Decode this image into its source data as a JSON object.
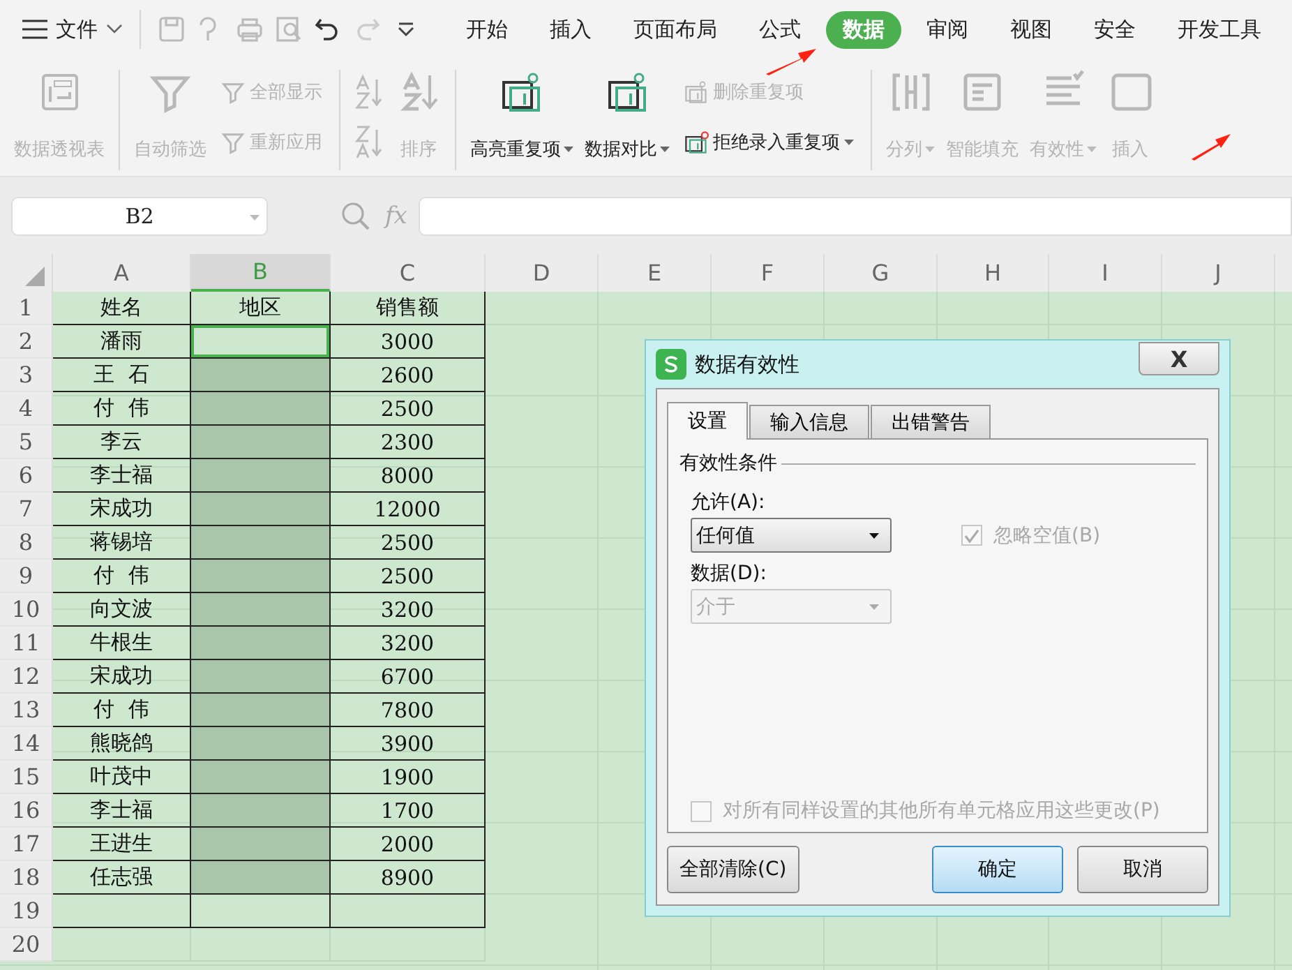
{
  "menu": {
    "file_label": "文件"
  },
  "tabs": [
    {
      "label": "开始",
      "selected": false
    },
    {
      "label": "插入",
      "selected": false
    },
    {
      "label": "页面布局",
      "selected": false
    },
    {
      "label": "公式",
      "selected": false
    },
    {
      "label": "数据",
      "selected": true
    },
    {
      "label": "审阅",
      "selected": false
    },
    {
      "label": "视图",
      "selected": false
    },
    {
      "label": "安全",
      "selected": false
    },
    {
      "label": "开发工具",
      "selected": false
    }
  ],
  "ribbon": [
    {
      "kind": "large",
      "label": "数据透视表",
      "disabled": true,
      "dropdown": false
    },
    {
      "kind": "separator"
    },
    {
      "kind": "large",
      "label": "自动筛选",
      "disabled": true,
      "dropdown": false
    },
    {
      "kind": "stack",
      "items": [
        {
          "label": "全部显示",
          "disabled": true,
          "dropdown": false
        },
        {
          "label": "重新应用",
          "disabled": true,
          "dropdown": false
        }
      ]
    },
    {
      "kind": "separator"
    },
    {
      "kind": "sortpair"
    },
    {
      "kind": "large",
      "label": "排序",
      "disabled": true,
      "dropdown": false
    },
    {
      "kind": "separator"
    },
    {
      "kind": "large",
      "label": "高亮重复项",
      "disabled": false,
      "dropdown": true
    },
    {
      "kind": "large",
      "label": "数据对比",
      "disabled": false,
      "dropdown": true
    },
    {
      "kind": "stack",
      "items": [
        {
          "label": "删除重复项",
          "disabled": true,
          "dropdown": false
        },
        {
          "label": "拒绝录入重复项",
          "disabled": false,
          "dropdown": true
        }
      ]
    },
    {
      "kind": "separator"
    },
    {
      "kind": "large",
      "label": "分列",
      "disabled": true,
      "dropdown": true
    },
    {
      "kind": "large",
      "label": "智能填充",
      "disabled": true,
      "dropdown": false
    },
    {
      "kind": "large",
      "label": "有效性",
      "disabled": true,
      "dropdown": true
    },
    {
      "kind": "large",
      "label": "插入",
      "disabled": true,
      "dropdown": false
    }
  ],
  "name_box": "B2",
  "formula_label": "fx",
  "columns": [
    {
      "label": "A",
      "selected": false
    },
    {
      "label": "B",
      "selected": true
    },
    {
      "label": "C",
      "selected": false
    },
    {
      "label": "D",
      "selected": false
    },
    {
      "label": "E",
      "selected": false
    },
    {
      "label": "F",
      "selected": false
    },
    {
      "label": "G",
      "selected": false
    },
    {
      "label": "H",
      "selected": false
    },
    {
      "label": "I",
      "selected": false
    },
    {
      "label": "J",
      "selected": false
    }
  ],
  "rows": [
    {
      "number": "1",
      "name": "姓名",
      "region": "地区",
      "sales": "销售额",
      "bordered": true,
      "region_selected": false,
      "region_active": false
    },
    {
      "number": "2",
      "name": "潘雨",
      "sales": "3000",
      "bordered": true,
      "region_selected": false,
      "region_active": true
    },
    {
      "number": "3",
      "name": "王  石",
      "sales": "2600",
      "bordered": true,
      "region_selected": true,
      "region_active": false
    },
    {
      "number": "4",
      "name": "付  伟",
      "sales": "2500",
      "bordered": true,
      "region_selected": true,
      "region_active": false
    },
    {
      "number": "5",
      "name": "李云",
      "sales": "2300",
      "bordered": true,
      "region_selected": true,
      "region_active": false
    },
    {
      "number": "6",
      "name": "李士福",
      "sales": "8000",
      "bordered": true,
      "region_selected": true,
      "region_active": false
    },
    {
      "number": "7",
      "name": "宋成功",
      "sales": "12000",
      "bordered": true,
      "region_selected": true,
      "region_active": false
    },
    {
      "number": "8",
      "name": "蒋锡培",
      "sales": "2500",
      "bordered": true,
      "region_selected": true,
      "region_active": false
    },
    {
      "number": "9",
      "name": "付  伟",
      "sales": "2500",
      "bordered": true,
      "region_selected": true,
      "region_active": false
    },
    {
      "number": "10",
      "name": "向文波",
      "sales": "3200",
      "bordered": true,
      "region_selected": true,
      "region_active": false
    },
    {
      "number": "11",
      "name": "牛根生",
      "sales": "3200",
      "bordered": true,
      "region_selected": true,
      "region_active": false
    },
    {
      "number": "12",
      "name": "宋成功",
      "sales": "6700",
      "bordered": true,
      "region_selected": true,
      "region_active": false
    },
    {
      "number": "13",
      "name": "付  伟",
      "sales": "7800",
      "bordered": true,
      "region_selected": true,
      "region_active": false
    },
    {
      "number": "14",
      "name": "熊晓鸽",
      "sales": "3900",
      "bordered": true,
      "region_selected": true,
      "region_active": false
    },
    {
      "number": "15",
      "name": "叶茂中",
      "sales": "1900",
      "bordered": true,
      "region_selected": true,
      "region_active": false
    },
    {
      "number": "16",
      "name": "李士福",
      "sales": "1700",
      "bordered": true,
      "region_selected": true,
      "region_active": false
    },
    {
      "number": "17",
      "name": "王进生",
      "sales": "2000",
      "bordered": true,
      "region_selected": true,
      "region_active": false
    },
    {
      "number": "18",
      "name": "任志强",
      "sales": "8900",
      "bordered": true,
      "region_selected": true,
      "region_active": false
    },
    {
      "number": "19",
      "bordered": true,
      "region_selected": false,
      "region_active": false
    },
    {
      "number": "20",
      "bordered": false,
      "region_selected": false,
      "region_active": false
    }
  ],
  "dialog": {
    "title": "数据有效性",
    "close": "X",
    "tabs": [
      {
        "label": "设置",
        "selected": true
      },
      {
        "label": "输入信息",
        "selected": false
      },
      {
        "label": "出错警告",
        "selected": false
      }
    ],
    "section": "有效性条件",
    "allow_label": "允许(A):",
    "allow_value": "任何值",
    "allow_disabled": false,
    "ignore_blank": {
      "label": "忽略空值(B)",
      "checked": true,
      "disabled": true
    },
    "data_label": "数据(D):",
    "data_value": "介于",
    "data_disabled": true,
    "apply_all": {
      "label": "对所有同样设置的其他所有单元格应用这些更改(P)",
      "checked": false,
      "disabled": true
    },
    "buttons": [
      {
        "label": "全部清除(C)",
        "kind": "normal"
      },
      {
        "label": "确定",
        "kind": "default"
      },
      {
        "label": "取消",
        "kind": "normal"
      }
    ]
  }
}
